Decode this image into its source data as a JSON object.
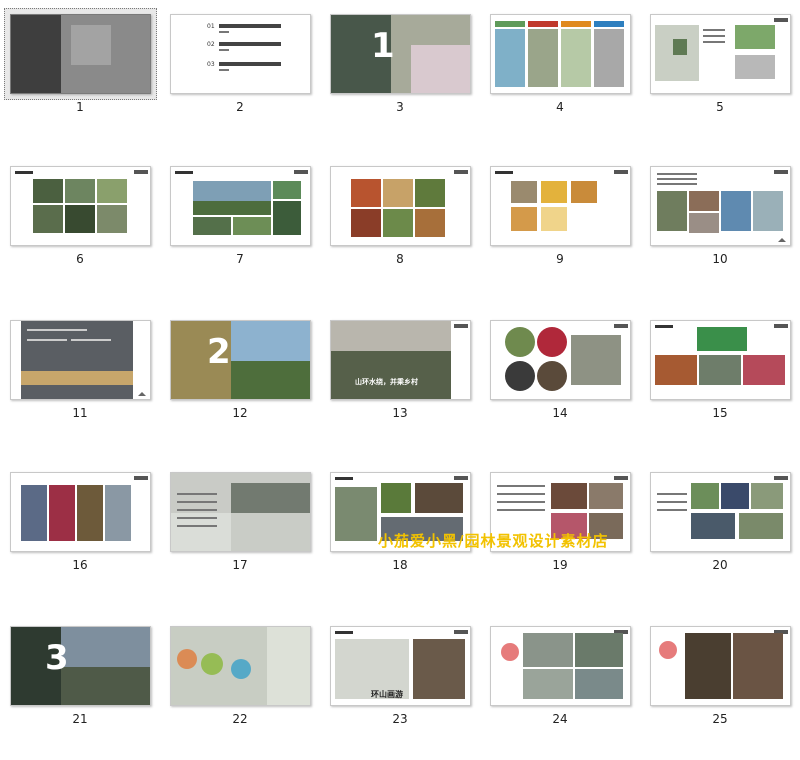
{
  "slides": [
    {
      "number": "1"
    },
    {
      "number": "2"
    },
    {
      "number": "3"
    },
    {
      "number": "4"
    },
    {
      "number": "5"
    },
    {
      "number": "6"
    },
    {
      "number": "7"
    },
    {
      "number": "8"
    },
    {
      "number": "9"
    },
    {
      "number": "10"
    },
    {
      "number": "11"
    },
    {
      "number": "12"
    },
    {
      "number": "13"
    },
    {
      "number": "14"
    },
    {
      "number": "15"
    },
    {
      "number": "16"
    },
    {
      "number": "17"
    },
    {
      "number": "18"
    },
    {
      "number": "19"
    },
    {
      "number": "20"
    },
    {
      "number": "21"
    },
    {
      "number": "22"
    },
    {
      "number": "23"
    },
    {
      "number": "24"
    },
    {
      "number": "25"
    }
  ],
  "selected_slide": "1",
  "slide_texts": {
    "s2_toc": [
      "01",
      "02",
      "03"
    ],
    "s3_big": "1",
    "s12_big": "2",
    "s13_caption": "山环水绕，并乘乡村",
    "s21_big": "3",
    "s23_caption": "环山画游"
  },
  "watermark": "小茄爱小黑/园林景观设计素材店",
  "colors": {
    "selection_border": "#7a7a7a",
    "watermark": "#f2c200"
  }
}
